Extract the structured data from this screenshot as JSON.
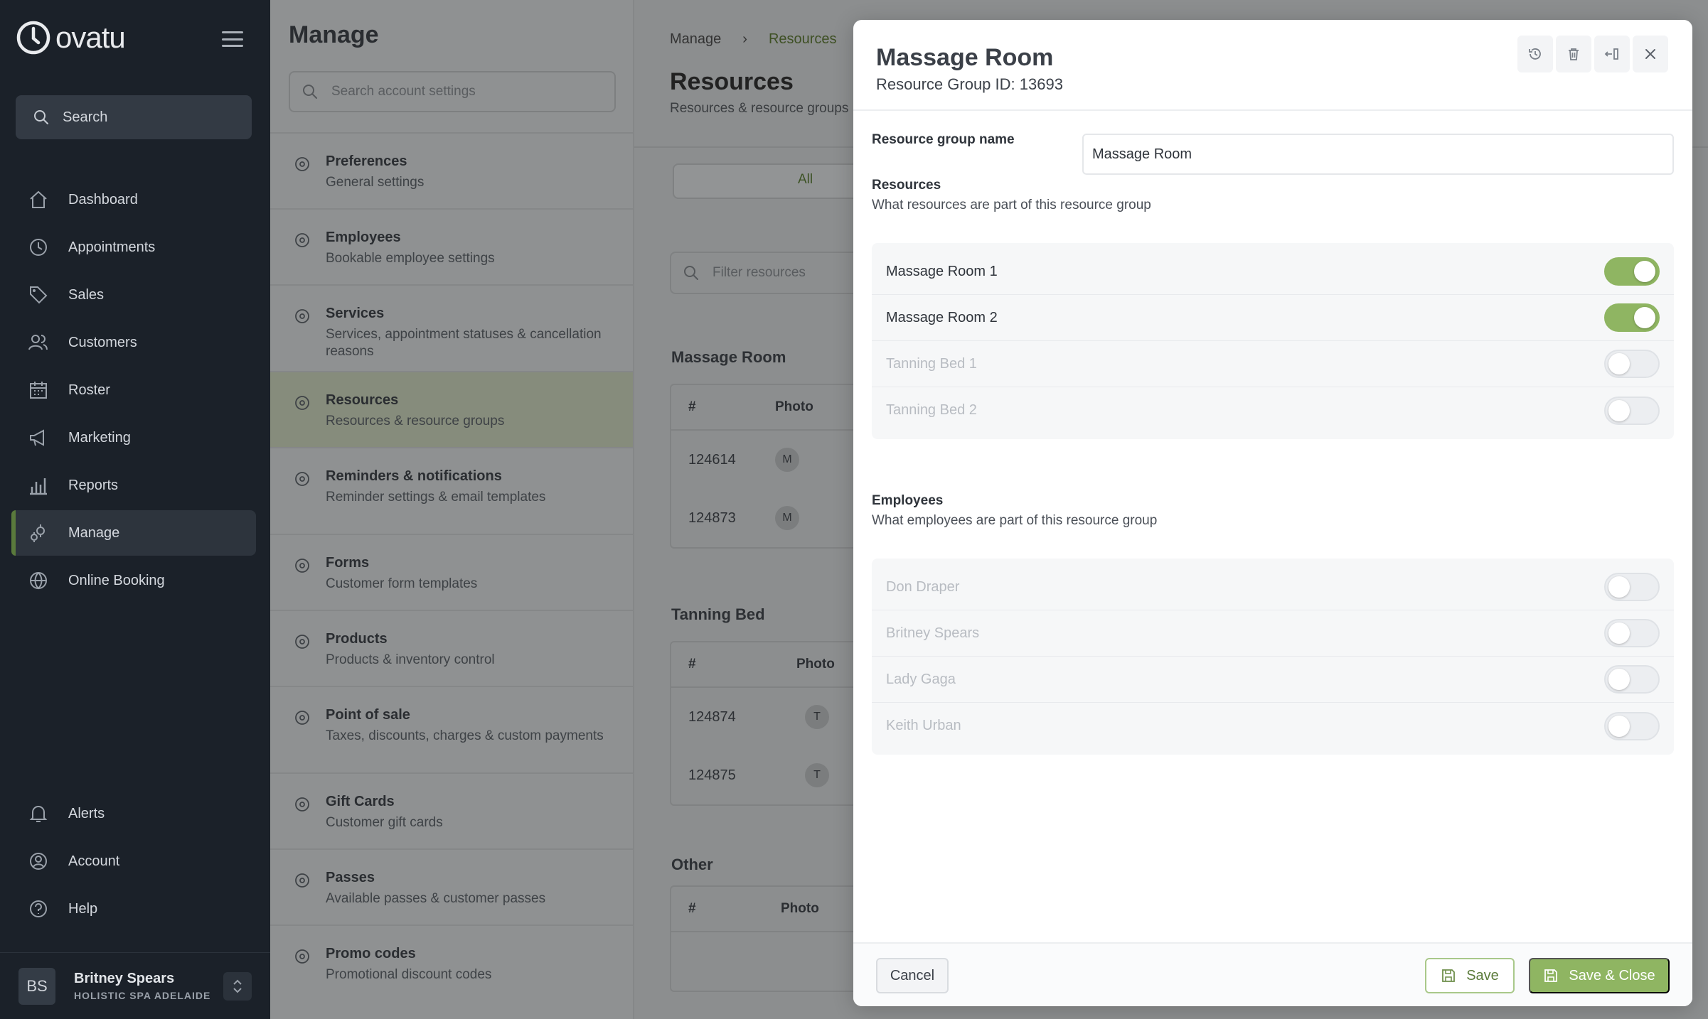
{
  "app": {
    "brand": "ovatu",
    "search_label": "Search",
    "nav": [
      {
        "label": "Dashboard",
        "icon": "home-icon",
        "active": false
      },
      {
        "label": "Appointments",
        "icon": "clock-icon",
        "active": false
      },
      {
        "label": "Sales",
        "icon": "tag-icon",
        "active": false
      },
      {
        "label": "Customers",
        "icon": "users-icon",
        "active": false
      },
      {
        "label": "Roster",
        "icon": "calendar-icon",
        "active": false
      },
      {
        "label": "Marketing",
        "icon": "megaphone-icon",
        "active": false
      },
      {
        "label": "Reports",
        "icon": "bar-chart-icon",
        "active": false
      },
      {
        "label": "Manage",
        "icon": "gears-icon",
        "active": true
      },
      {
        "label": "Online Booking",
        "icon": "globe-icon",
        "active": false
      }
    ],
    "bottom_nav": [
      {
        "label": "Alerts",
        "icon": "bell-icon"
      },
      {
        "label": "Account",
        "icon": "account-icon"
      },
      {
        "label": "Help",
        "icon": "help-icon"
      }
    ],
    "user": {
      "initials": "BS",
      "name": "Britney Spears",
      "org": "HOLISTIC SPA ADELAIDE"
    }
  },
  "manage": {
    "title": "Manage",
    "search_placeholder": "Search account settings",
    "items": [
      {
        "title": "Preferences",
        "sub": "General settings",
        "icon": "gears-icon",
        "active": false
      },
      {
        "title": "Employees",
        "sub": "Bookable employee settings",
        "icon": "person-icon",
        "active": false
      },
      {
        "title": "Services",
        "sub": "Services, appointment statuses & cancellation reasons",
        "icon": "hand-gear-icon",
        "active": false
      },
      {
        "title": "Resources",
        "sub": "Resources & resource groups",
        "icon": "tools-icon",
        "active": true
      },
      {
        "title": "Reminders & notifications",
        "sub": "Reminder settings & email templates",
        "icon": "alarm-icon",
        "active": false
      },
      {
        "title": "Forms",
        "sub": "Customer form templates",
        "icon": "form-icon",
        "active": false
      },
      {
        "title": "Products",
        "sub": "Products & inventory control",
        "icon": "box-icon",
        "active": false
      },
      {
        "title": "Point of sale",
        "sub": "Taxes, discounts, charges & custom payments",
        "icon": "money-hand-icon",
        "active": false
      },
      {
        "title": "Gift Cards",
        "sub": "Customer gift cards",
        "icon": "gift-icon",
        "active": false
      },
      {
        "title": "Passes",
        "sub": "Available passes & customer passes",
        "icon": "ticket-icon",
        "active": false
      },
      {
        "title": "Promo codes",
        "sub": "Promotional discount codes",
        "icon": "ticket-icon",
        "active": false
      }
    ]
  },
  "resources_page": {
    "breadcrumb": [
      "Manage",
      "Resources"
    ],
    "title": "Resources",
    "subtitle": "Resources & resource groups",
    "tab_all": "All",
    "filter_placeholder": "Filter resources",
    "col_num": "#",
    "col_photo": "Photo",
    "groups": [
      {
        "name": "Massage Room",
        "rows": [
          {
            "id": "124614",
            "initial": "M"
          },
          {
            "id": "124873",
            "initial": "M"
          }
        ]
      },
      {
        "name": "Tanning Bed",
        "rows": [
          {
            "id": "124874",
            "initial": "T"
          },
          {
            "id": "124875",
            "initial": "T"
          }
        ]
      },
      {
        "name": "Other",
        "rows": []
      }
    ]
  },
  "modal": {
    "title": "Massage Room",
    "subtitle": "Resource Group ID: 13693",
    "name_label": "Resource group name",
    "name_value": "Massage Room",
    "resources_title": "Resources",
    "resources_desc": "What resources are part of this resource group",
    "resources": [
      {
        "label": "Massage Room 1",
        "on": true
      },
      {
        "label": "Massage Room 2",
        "on": true
      },
      {
        "label": "Tanning Bed 1",
        "on": false
      },
      {
        "label": "Tanning Bed 2",
        "on": false
      }
    ],
    "employees_title": "Employees",
    "employees_desc": "What employees are part of this resource group",
    "employees": [
      {
        "label": "Don Draper",
        "on": false
      },
      {
        "label": "Britney Spears",
        "on": false
      },
      {
        "label": "Lady Gaga",
        "on": false
      },
      {
        "label": "Keith Urban",
        "on": false
      }
    ],
    "cancel_label": "Cancel",
    "save_label": "Save",
    "save_close_label": "Save & Close"
  },
  "colors": {
    "accent": "#8fb562",
    "sidebar": "#1b2129"
  }
}
